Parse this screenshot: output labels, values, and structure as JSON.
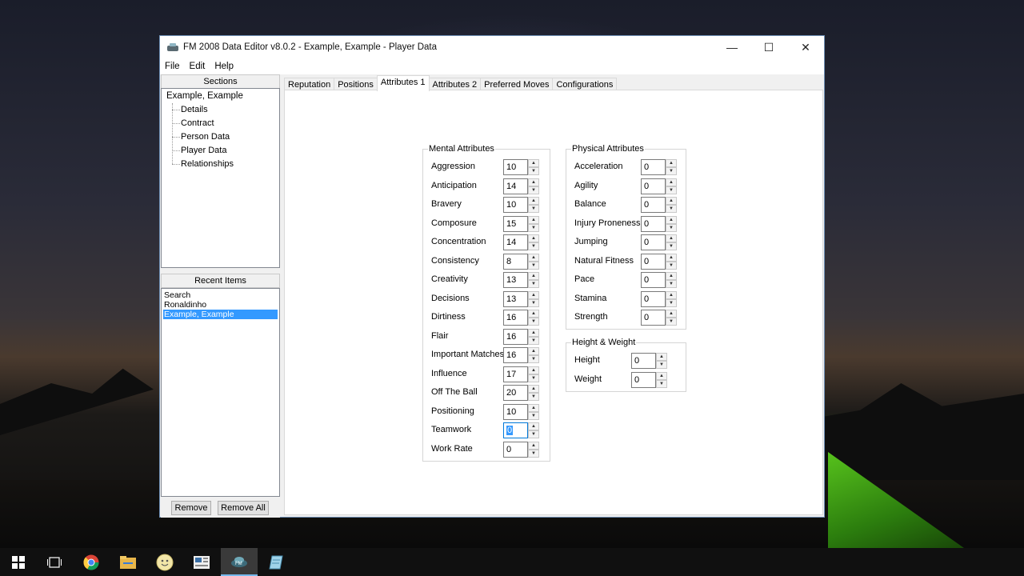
{
  "window": {
    "title": "FM 2008 Data Editor v8.0.2 - Example, Example - Player Data",
    "controls": {
      "minimize": "—",
      "maximize": "☐",
      "close": "✕"
    }
  },
  "menu": [
    "File",
    "Edit",
    "Help"
  ],
  "sections": {
    "header": "Sections",
    "root": "Example, Example",
    "items": [
      "Details",
      "Contract",
      "Person Data",
      "Player Data",
      "Relationships"
    ]
  },
  "recent": {
    "header": "Recent Items",
    "items": [
      "Search",
      "Ronaldinho",
      "Example, Example"
    ],
    "selected_index": 2,
    "remove_label": "Remove",
    "remove_all_label": "Remove All"
  },
  "tabs": [
    "Reputation",
    "Positions",
    "Attributes 1",
    "Attributes 2",
    "Preferred Moves",
    "Configurations"
  ],
  "active_tab": "Attributes 1",
  "mental": {
    "title": "Mental Attributes",
    "rows": [
      {
        "label": "Aggression",
        "value": "10"
      },
      {
        "label": "Anticipation",
        "value": "14"
      },
      {
        "label": "Bravery",
        "value": "10"
      },
      {
        "label": "Composure",
        "value": "15"
      },
      {
        "label": "Concentration",
        "value": "14"
      },
      {
        "label": "Consistency",
        "value": "8"
      },
      {
        "label": "Creativity",
        "value": "13"
      },
      {
        "label": "Decisions",
        "value": "13"
      },
      {
        "label": "Dirtiness",
        "value": "16"
      },
      {
        "label": "Flair",
        "value": "16"
      },
      {
        "label": "Important Matches",
        "value": "16"
      },
      {
        "label": "Influence",
        "value": "17"
      },
      {
        "label": "Off The Ball",
        "value": "20"
      },
      {
        "label": "Positioning",
        "value": "10"
      },
      {
        "label": "Teamwork",
        "value": "0"
      },
      {
        "label": "Work Rate",
        "value": "0"
      }
    ]
  },
  "physical": {
    "title": "Physical Attributes",
    "rows": [
      {
        "label": "Acceleration",
        "value": "0"
      },
      {
        "label": "Agility",
        "value": "0"
      },
      {
        "label": "Balance",
        "value": "0"
      },
      {
        "label": "Injury Proneness",
        "value": "0"
      },
      {
        "label": "Jumping",
        "value": "0"
      },
      {
        "label": "Natural Fitness",
        "value": "0"
      },
      {
        "label": "Pace",
        "value": "0"
      },
      {
        "label": "Stamina",
        "value": "0"
      },
      {
        "label": "Strength",
        "value": "0"
      }
    ]
  },
  "height_weight": {
    "title": "Height & Weight",
    "rows": [
      {
        "label": "Height",
        "value": "0"
      },
      {
        "label": "Weight",
        "value": "0"
      }
    ]
  },
  "taskbar": [
    "start-icon",
    "task-view-icon",
    "chrome-icon",
    "file-explorer-icon",
    "smiley-app-icon",
    "news-app-icon",
    "fm-editor-icon",
    "notepad-icon"
  ]
}
